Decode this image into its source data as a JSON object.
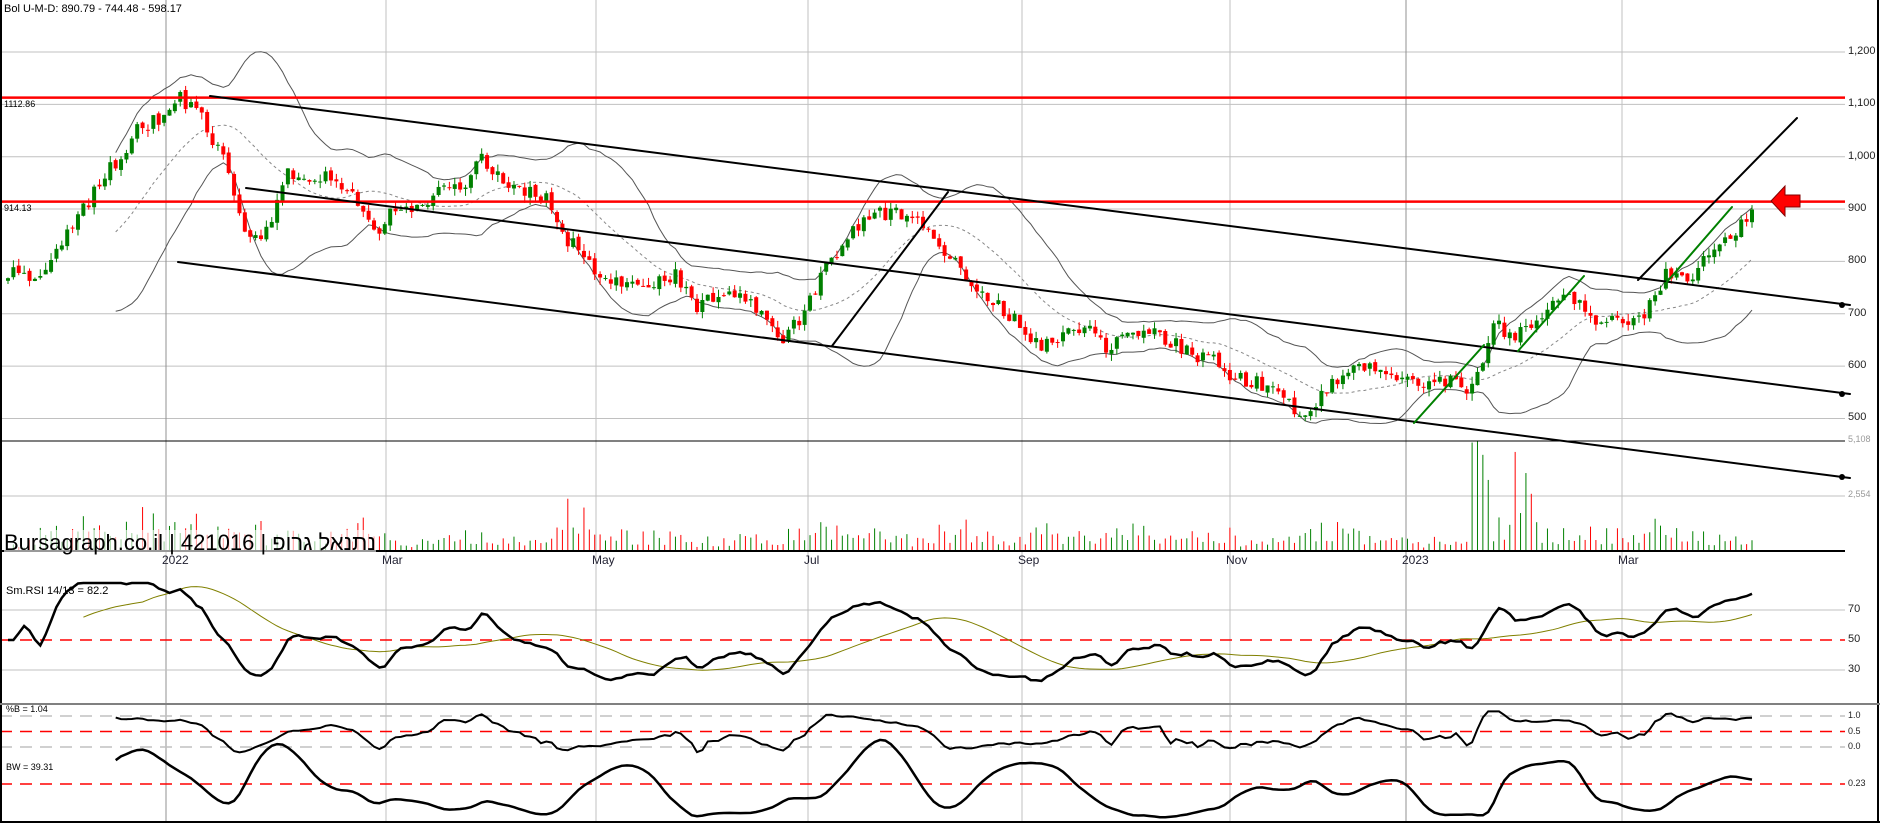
{
  "header": {
    "bollinger_legend": "Bol U-M-D: 890.79 - 744.48 - 598.17"
  },
  "watermark": "Bursagraph.co.il | 421016 | נתנאל גרופ",
  "levels": [
    {
      "value": 1112.86,
      "label": "1112.86"
    },
    {
      "value": 914.13,
      "label": "914.13"
    }
  ],
  "colors": {
    "up": "#008000",
    "down": "#ff0000",
    "level": "#ff0000",
    "grid": "#c0c0c0",
    "signal": "#808000",
    "trend_green": "#008000"
  },
  "chart_data": {
    "type": "candlestick",
    "price_axis": {
      "ticks": [
        "1,200",
        "1,100",
        "1,000",
        "900",
        "800",
        "700",
        "600",
        "500"
      ],
      "values": [
        1200,
        1100,
        1000,
        900,
        800,
        700,
        600,
        500
      ],
      "range": [
        470,
        1250
      ]
    },
    "volume_axis": {
      "ticks": [
        "5,108",
        "2,554"
      ],
      "values": [
        5108,
        2554
      ]
    },
    "date_labels": [
      "2022",
      "Mar",
      "May",
      "Jul",
      "Sep",
      "Nov",
      "2023",
      "Mar"
    ],
    "closes": [
      778,
      773,
      796,
      865,
      934,
      991,
      1049,
      1071,
      1113,
      1071,
      991,
      853,
      853,
      968,
      957,
      968,
      934,
      853,
      899,
      899,
      934,
      938,
      1003,
      945,
      934,
      922,
      842,
      796,
      762,
      751,
      762,
      773,
      716,
      739,
      739,
      693,
      647,
      704,
      785,
      842,
      888,
      893,
      876,
      853,
      796,
      739,
      716,
      681,
      635,
      658,
      681,
      635,
      670,
      670,
      647,
      624,
      612,
      578,
      567,
      544,
      509,
      544,
      589,
      601,
      589,
      567,
      567,
      578,
      555,
      681,
      658,
      693,
      739,
      716,
      681,
      685,
      693,
      773,
      762,
      808,
      842,
      899
    ],
    "volumes": [
      300,
      900,
      1200,
      1500,
      1100,
      1400,
      1800,
      1300,
      2000,
      1000,
      900,
      1200,
      700,
      800,
      600,
      900,
      1300,
      700,
      600,
      500,
      700,
      900,
      800,
      600,
      500,
      1100,
      2400,
      1400,
      1000,
      800,
      900,
      700,
      600,
      500,
      700,
      800,
      1000,
      1400,
      1200,
      1000,
      900,
      800,
      700,
      1100,
      1300,
      900,
      800,
      1000,
      1200,
      800,
      700,
      900,
      1100,
      700,
      600,
      800,
      1000,
      600,
      500,
      700,
      900,
      1300,
      900,
      800,
      600,
      500,
      700,
      500,
      4800,
      1400,
      4700,
      1200,
      900,
      1000,
      900,
      700,
      1400,
      900,
      800,
      700,
      600,
      500
    ],
    "indicators": {
      "rsi": {
        "label": "Sm.RSI 14/13 = 82.2",
        "ticks": [
          "70",
          "50",
          "30"
        ],
        "values": [
          70,
          50,
          30
        ]
      },
      "percent_b": {
        "label": "%B = 1.04",
        "ticks": [
          "1.0",
          "0.5",
          "0.0"
        ],
        "values": [
          1,
          0.5,
          0
        ]
      },
      "bandwidth": {
        "label": "BW = 39.31",
        "ticks": [
          "0.23"
        ],
        "values": [
          0.23
        ]
      }
    }
  }
}
